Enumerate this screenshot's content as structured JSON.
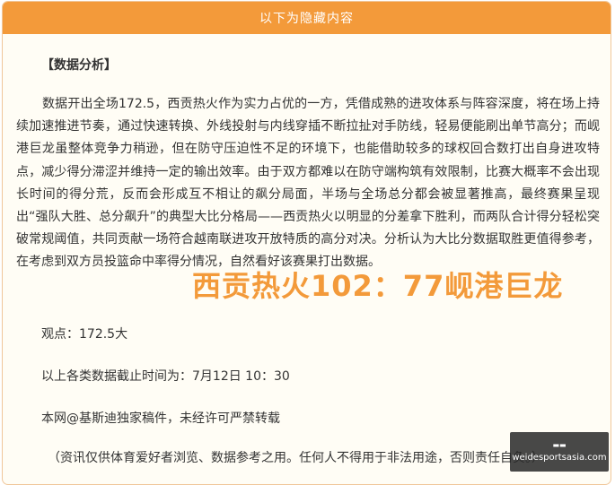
{
  "header": {
    "title": "以下为隐藏内容"
  },
  "article": {
    "section_title": "【数据分析】",
    "paragraph": "数据开出全场172.5，西贡热火作为实力占优的一方，凭借成熟的进攻体系与阵容深度，将在场上持续加速推进节奏，通过快速转换、外线投射与内线穿插不断拉扯对手防线，轻易便能刷出单节高分；而岘港巨龙虽整体竞争力稍逊，但在防守压迫性不足的环境下，也能借助较多的球权回合数打出自身进攻特点，减少得分滞涩并维持一定的输出效率。由于双方都难以在防守端构筑有效限制，比赛大概率不会出现长时间的得分荒，反而会形成互不相让的飙分局面，半场与全场总分都会被显著推高，最终赛果呈现出“强队大胜、总分飙升”的典型大比分格局——西贡热火以明显的分差拿下胜利，而两队合计得分轻松突破常规阈值，共同贡献一场符合越南联进攻开放特质的高分对决。分析认为大比分数据取胜更值得参考，在考虑到双方员投篮命中率得分情况，自然看好该赛果打出数据。",
    "score_overlay": "西贡热火102：77岘港巨龙",
    "viewpoint": "观点：172.5大",
    "data_time": "以上各类数据截止时间为：7月12日 10：30",
    "copyright": "本网@基斯迪独家稿件，未经许可严禁转载",
    "disclaimer": "（资讯仅供体育爱好者浏览、数据参考之用。任何人不得用于非法用途，否则责任自负。）"
  },
  "watermark": {
    "icon": "logo-icon",
    "text": "weidesportsasia.com"
  }
}
